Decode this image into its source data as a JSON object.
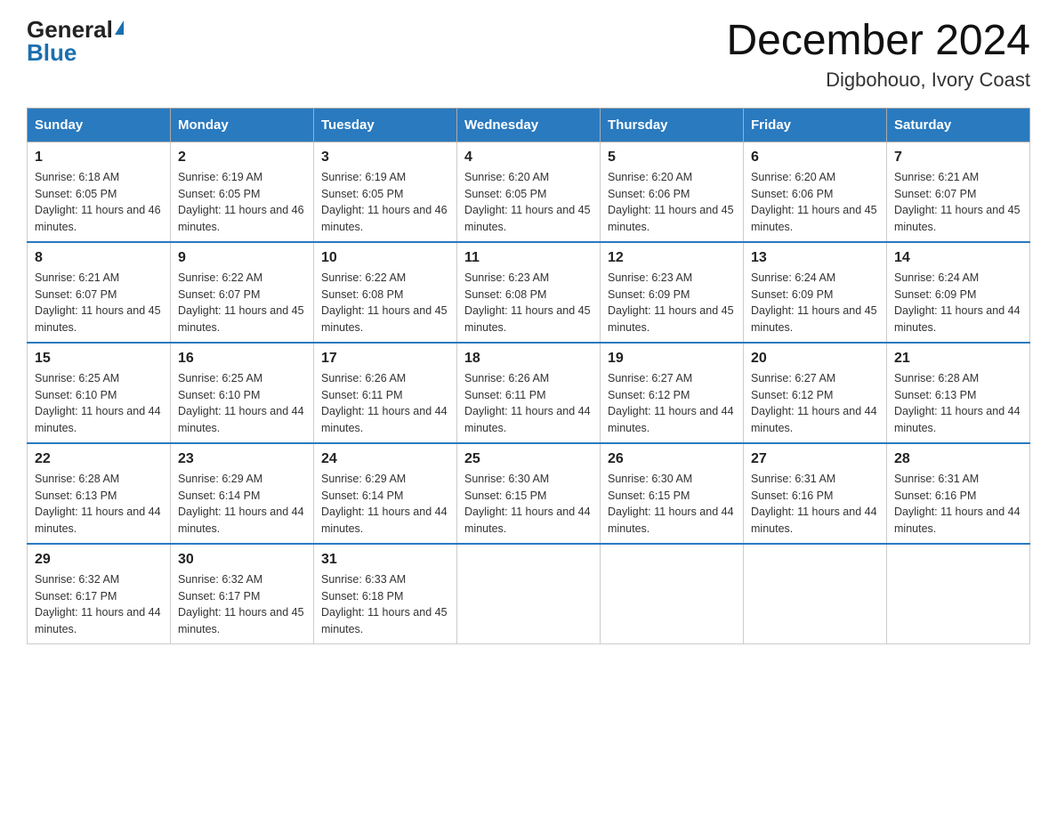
{
  "header": {
    "logo_general": "General",
    "logo_blue": "Blue",
    "title": "December 2024",
    "subtitle": "Digbohouo, Ivory Coast"
  },
  "weekdays": [
    "Sunday",
    "Monday",
    "Tuesday",
    "Wednesday",
    "Thursday",
    "Friday",
    "Saturday"
  ],
  "weeks": [
    [
      {
        "day": "1",
        "sunrise": "6:18 AM",
        "sunset": "6:05 PM",
        "daylight": "11 hours and 46 minutes."
      },
      {
        "day": "2",
        "sunrise": "6:19 AM",
        "sunset": "6:05 PM",
        "daylight": "11 hours and 46 minutes."
      },
      {
        "day": "3",
        "sunrise": "6:19 AM",
        "sunset": "6:05 PM",
        "daylight": "11 hours and 46 minutes."
      },
      {
        "day": "4",
        "sunrise": "6:20 AM",
        "sunset": "6:05 PM",
        "daylight": "11 hours and 45 minutes."
      },
      {
        "day": "5",
        "sunrise": "6:20 AM",
        "sunset": "6:06 PM",
        "daylight": "11 hours and 45 minutes."
      },
      {
        "day": "6",
        "sunrise": "6:20 AM",
        "sunset": "6:06 PM",
        "daylight": "11 hours and 45 minutes."
      },
      {
        "day": "7",
        "sunrise": "6:21 AM",
        "sunset": "6:07 PM",
        "daylight": "11 hours and 45 minutes."
      }
    ],
    [
      {
        "day": "8",
        "sunrise": "6:21 AM",
        "sunset": "6:07 PM",
        "daylight": "11 hours and 45 minutes."
      },
      {
        "day": "9",
        "sunrise": "6:22 AM",
        "sunset": "6:07 PM",
        "daylight": "11 hours and 45 minutes."
      },
      {
        "day": "10",
        "sunrise": "6:22 AM",
        "sunset": "6:08 PM",
        "daylight": "11 hours and 45 minutes."
      },
      {
        "day": "11",
        "sunrise": "6:23 AM",
        "sunset": "6:08 PM",
        "daylight": "11 hours and 45 minutes."
      },
      {
        "day": "12",
        "sunrise": "6:23 AM",
        "sunset": "6:09 PM",
        "daylight": "11 hours and 45 minutes."
      },
      {
        "day": "13",
        "sunrise": "6:24 AM",
        "sunset": "6:09 PM",
        "daylight": "11 hours and 45 minutes."
      },
      {
        "day": "14",
        "sunrise": "6:24 AM",
        "sunset": "6:09 PM",
        "daylight": "11 hours and 44 minutes."
      }
    ],
    [
      {
        "day": "15",
        "sunrise": "6:25 AM",
        "sunset": "6:10 PM",
        "daylight": "11 hours and 44 minutes."
      },
      {
        "day": "16",
        "sunrise": "6:25 AM",
        "sunset": "6:10 PM",
        "daylight": "11 hours and 44 minutes."
      },
      {
        "day": "17",
        "sunrise": "6:26 AM",
        "sunset": "6:11 PM",
        "daylight": "11 hours and 44 minutes."
      },
      {
        "day": "18",
        "sunrise": "6:26 AM",
        "sunset": "6:11 PM",
        "daylight": "11 hours and 44 minutes."
      },
      {
        "day": "19",
        "sunrise": "6:27 AM",
        "sunset": "6:12 PM",
        "daylight": "11 hours and 44 minutes."
      },
      {
        "day": "20",
        "sunrise": "6:27 AM",
        "sunset": "6:12 PM",
        "daylight": "11 hours and 44 minutes."
      },
      {
        "day": "21",
        "sunrise": "6:28 AM",
        "sunset": "6:13 PM",
        "daylight": "11 hours and 44 minutes."
      }
    ],
    [
      {
        "day": "22",
        "sunrise": "6:28 AM",
        "sunset": "6:13 PM",
        "daylight": "11 hours and 44 minutes."
      },
      {
        "day": "23",
        "sunrise": "6:29 AM",
        "sunset": "6:14 PM",
        "daylight": "11 hours and 44 minutes."
      },
      {
        "day": "24",
        "sunrise": "6:29 AM",
        "sunset": "6:14 PM",
        "daylight": "11 hours and 44 minutes."
      },
      {
        "day": "25",
        "sunrise": "6:30 AM",
        "sunset": "6:15 PM",
        "daylight": "11 hours and 44 minutes."
      },
      {
        "day": "26",
        "sunrise": "6:30 AM",
        "sunset": "6:15 PM",
        "daylight": "11 hours and 44 minutes."
      },
      {
        "day": "27",
        "sunrise": "6:31 AM",
        "sunset": "6:16 PM",
        "daylight": "11 hours and 44 minutes."
      },
      {
        "day": "28",
        "sunrise": "6:31 AM",
        "sunset": "6:16 PM",
        "daylight": "11 hours and 44 minutes."
      }
    ],
    [
      {
        "day": "29",
        "sunrise": "6:32 AM",
        "sunset": "6:17 PM",
        "daylight": "11 hours and 44 minutes."
      },
      {
        "day": "30",
        "sunrise": "6:32 AM",
        "sunset": "6:17 PM",
        "daylight": "11 hours and 45 minutes."
      },
      {
        "day": "31",
        "sunrise": "6:33 AM",
        "sunset": "6:18 PM",
        "daylight": "11 hours and 45 minutes."
      },
      null,
      null,
      null,
      null
    ]
  ]
}
